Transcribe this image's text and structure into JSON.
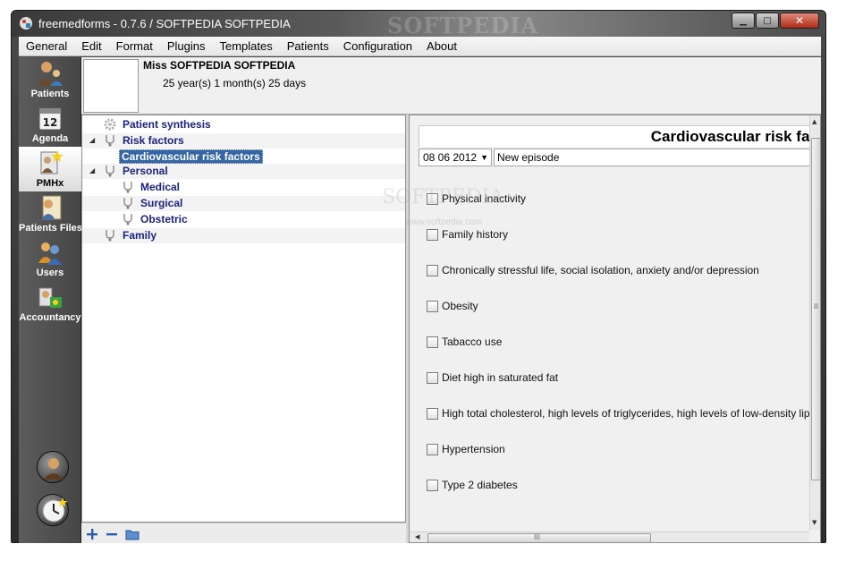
{
  "window": {
    "title": "freemedforms - 0.7.6 /  SOFTPEDIA SOFTPEDIA",
    "watermark": "SOFTPEDIA"
  },
  "menu": [
    "General",
    "Edit",
    "Format",
    "Plugins",
    "Templates",
    "Patients",
    "Configuration",
    "About"
  ],
  "sidebar": {
    "items": [
      {
        "label": "Patients",
        "icon": "patients-icon"
      },
      {
        "label": "Agenda",
        "icon": "calendar-icon",
        "day": "12"
      },
      {
        "label": "PMHx",
        "icon": "pmhx-icon"
      },
      {
        "label": "Patients Files",
        "icon": "patient-files-icon"
      },
      {
        "label": "Users",
        "icon": "users-icon"
      },
      {
        "label": "Accountancy",
        "icon": "accountancy-icon"
      }
    ],
    "active": "PMHx"
  },
  "patient": {
    "name": "Miss SOFTPEDIA SOFTPEDIA",
    "age": "25 year(s) 1 month(s) 25 days"
  },
  "tree": [
    {
      "label": "Patient synthesis",
      "icon": "gear-icon",
      "level": 0
    },
    {
      "label": "Risk factors",
      "icon": "stethoscope-icon",
      "level": 0,
      "expanded": true
    },
    {
      "label": "Cardiovascular risk factors",
      "icon": "",
      "level": 1,
      "selected": true
    },
    {
      "label": "Personal",
      "icon": "stethoscope-icon",
      "level": 0,
      "expanded": true
    },
    {
      "label": "Medical",
      "icon": "stethoscope-icon",
      "level": 1
    },
    {
      "label": "Surgical",
      "icon": "stethoscope-icon",
      "level": 1
    },
    {
      "label": "Obstetric",
      "icon": "stethoscope-icon",
      "level": 1
    },
    {
      "label": "Family",
      "icon": "stethoscope-icon",
      "level": 0
    }
  ],
  "form": {
    "title": "Cardiovascular risk factors",
    "date": "08 06 2012",
    "episode": "New episode",
    "items": [
      "Physical inactivity",
      "Family history",
      "Chronically stressful life, social isolation, anxiety and/or depression",
      "Obesity",
      "Tabacco use",
      "Diet high in saturated fat",
      "High total cholesterol, high levels of triglycerides, high levels of low-density lipoprotein",
      "Hypertension",
      "Type 2 diabetes"
    ],
    "hscroll_grip": "III",
    "vscroll_grip": "III"
  },
  "watermarks": {
    "body": "SOFTPEDIA",
    "url": "www.softpedia.com"
  }
}
